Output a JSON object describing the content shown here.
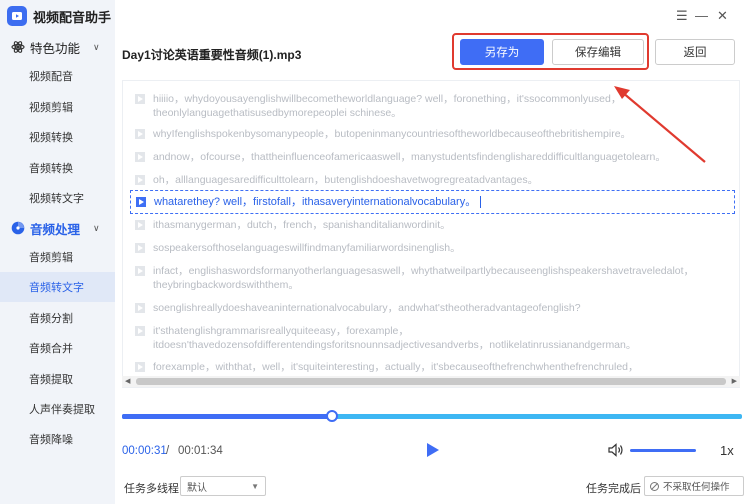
{
  "app": {
    "title": "视频配音助手",
    "brand_color": "#3c6df0",
    "window_controls": {
      "menu": "☰",
      "minimize": "—",
      "close": "✕"
    }
  },
  "sidebar": {
    "groups": [
      {
        "label": "特色功能",
        "icon": "atom-icon",
        "active": false,
        "items": [
          {
            "label": "视频配音"
          },
          {
            "label": "视频剪辑"
          },
          {
            "label": "视频转换"
          },
          {
            "label": "音频转换"
          },
          {
            "label": "视频转文字"
          }
        ]
      },
      {
        "label": "音频处理",
        "icon": "audio-disc-icon",
        "active": true,
        "items": [
          {
            "label": "音频剪辑"
          },
          {
            "label": "音频转文字",
            "selected": true
          },
          {
            "label": "音频分割"
          },
          {
            "label": "音频合并"
          },
          {
            "label": "音频提取"
          },
          {
            "label": "人声伴奏提取"
          },
          {
            "label": "音频降噪"
          }
        ]
      }
    ]
  },
  "header": {
    "file_name": "Day1讨论英语重要性音频(1).mp3",
    "save_as_label": "另存为",
    "save_edit_label": "保存编辑",
    "back_label": "返回",
    "highlight_color": "#e03a2f"
  },
  "transcript": {
    "lines": [
      {
        "text": "hiiiio，whydoyousayenglishwillbecometheworldlanguage? well，foronething，it'ssocommonlyused，",
        "text2": "theonlylanguagethatisusedbymorepeoplei schinese。"
      },
      {
        "text": "whyIfenglishspokenbysomanypeople，butopeninmanycountriesoftheworldbecauseofthebritishempire。"
      },
      {
        "text": "andnow，ofcourse，thattheinfluenceofamericaaswell，manystudentsfindenglishareddifficultlanguagetolearn。"
      },
      {
        "text": "oh，alllanguagesaredifficulttolearn，butenglishdoeshavetwogregreatadvantages。"
      },
      {
        "text": "whatarethey? well，firstofall，ithasaveryinternationalvocabulary。",
        "active": true
      },
      {
        "text": "ithasmanygerman，dutch，french，spanishanditalianwordinit。"
      },
      {
        "text": "sospeakersofthoselanguageswillfindmanyfamiliarwordsinenglish。"
      },
      {
        "text": "infact，englishaswordsformanyotherlanguagesaswell，whythatweilpartlybecauseenglishspeakershavetraveledalot，",
        "text2": "theybringbackwordswiththem。"
      },
      {
        "text": "soenglishreallydoeshaveaninternationalvocabulary，andwhat'stheotheradvantageofenglish?"
      },
      {
        "text": "it'sthatenglishgrammarisreallyquiteeasy，forexample，",
        "text2": "itdoesn'thavedozensofdifferentendingsforitsnounnsadjectivesandverbs，notlikelatinrussianandgerman。"
      },
      {
        "text": "forexample，withthat，well，it'squiteinteresting，actually，it'sbecauseofthefrenchwhenthefrenchruled，"
      }
    ]
  },
  "player": {
    "current_time": "00:00:31",
    "separator": "/",
    "total_time": "00:01:34",
    "progress": 0.338,
    "volume": 1.0,
    "speed": "1x",
    "progress_color": "#3f6df5",
    "remaining_color": "#3db7f3"
  },
  "bottom_bar": {
    "thread_label": "任务多线程",
    "thread_value": "默认",
    "done_label": "任务完成后",
    "done_value": "不采取任何操作"
  }
}
